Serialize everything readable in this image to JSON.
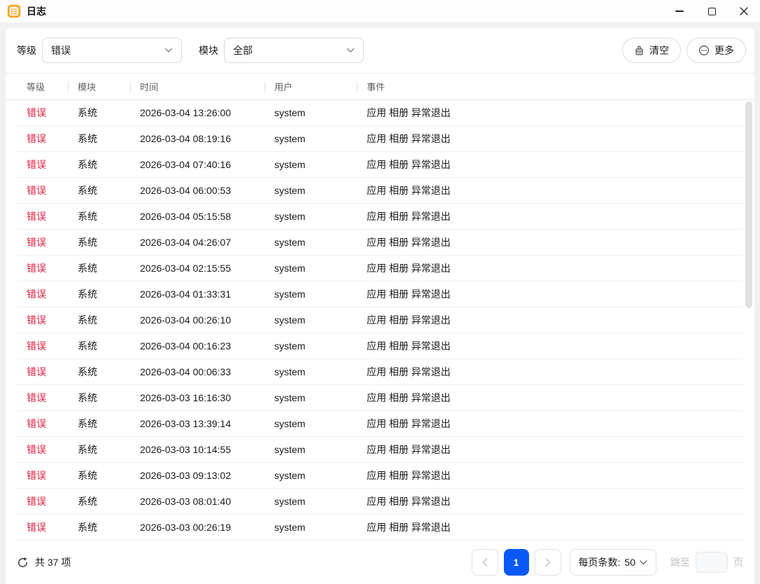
{
  "window": {
    "title": "日志"
  },
  "filters": {
    "level": {
      "label": "等级",
      "value": "错误"
    },
    "module": {
      "label": "模块",
      "value": "全部"
    }
  },
  "actions": {
    "clear": "清空",
    "more": "更多"
  },
  "table": {
    "columns": [
      "等级",
      "模块",
      "时间",
      "用户",
      "事件"
    ],
    "rows": [
      {
        "level": "错误",
        "module": "系统",
        "time": "2026-03-04 13:26:00",
        "user": "system",
        "event": "应用 相册 异常退出"
      },
      {
        "level": "错误",
        "module": "系统",
        "time": "2026-03-04 08:19:16",
        "user": "system",
        "event": "应用 相册 异常退出"
      },
      {
        "level": "错误",
        "module": "系统",
        "time": "2026-03-04 07:40:16",
        "user": "system",
        "event": "应用 相册 异常退出"
      },
      {
        "level": "错误",
        "module": "系统",
        "time": "2026-03-04 06:00:53",
        "user": "system",
        "event": "应用 相册 异常退出"
      },
      {
        "level": "错误",
        "module": "系统",
        "time": "2026-03-04 05:15:58",
        "user": "system",
        "event": "应用 相册 异常退出"
      },
      {
        "level": "错误",
        "module": "系统",
        "time": "2026-03-04 04:26:07",
        "user": "system",
        "event": "应用 相册 异常退出"
      },
      {
        "level": "错误",
        "module": "系统",
        "time": "2026-03-04 02:15:55",
        "user": "system",
        "event": "应用 相册 异常退出"
      },
      {
        "level": "错误",
        "module": "系统",
        "time": "2026-03-04 01:33:31",
        "user": "system",
        "event": "应用 相册 异常退出"
      },
      {
        "level": "错误",
        "module": "系统",
        "time": "2026-03-04 00:26:10",
        "user": "system",
        "event": "应用 相册 异常退出"
      },
      {
        "level": "错误",
        "module": "系统",
        "time": "2026-03-04 00:16:23",
        "user": "system",
        "event": "应用 相册 异常退出"
      },
      {
        "level": "错误",
        "module": "系统",
        "time": "2026-03-04 00:06:33",
        "user": "system",
        "event": "应用 相册 异常退出"
      },
      {
        "level": "错误",
        "module": "系统",
        "time": "2026-03-03 16:16:30",
        "user": "system",
        "event": "应用 相册 异常退出"
      },
      {
        "level": "错误",
        "module": "系统",
        "time": "2026-03-03 13:39:14",
        "user": "system",
        "event": "应用 相册 异常退出"
      },
      {
        "level": "错误",
        "module": "系统",
        "time": "2026-03-03 10:14:55",
        "user": "system",
        "event": "应用 相册 异常退出"
      },
      {
        "level": "错误",
        "module": "系统",
        "time": "2026-03-03 09:13:02",
        "user": "system",
        "event": "应用 相册 异常退出"
      },
      {
        "level": "错误",
        "module": "系统",
        "time": "2026-03-03 08:01:40",
        "user": "system",
        "event": "应用 相册 异常退出"
      },
      {
        "level": "错误",
        "module": "系统",
        "time": "2026-03-03 00:26:19",
        "user": "system",
        "event": "应用 相册 异常退出"
      }
    ]
  },
  "footer": {
    "total": "共 37 项",
    "page": "1",
    "page_size_label": "每页条数:",
    "page_size_value": "50",
    "jump_prefix": "跳至",
    "jump_suffix": "页"
  },
  "icons": {
    "app": "clipboard-list",
    "clear": "broom",
    "more": "ellipsis-circle",
    "refresh": "circular-arrow",
    "dropdown": "chevron-down",
    "prev": "chevron-left",
    "next": "chevron-right"
  },
  "colors": {
    "error_red": "#dc1e3e",
    "accent_blue": "#0a59f7",
    "app_icon_orange": "#f5a623"
  }
}
